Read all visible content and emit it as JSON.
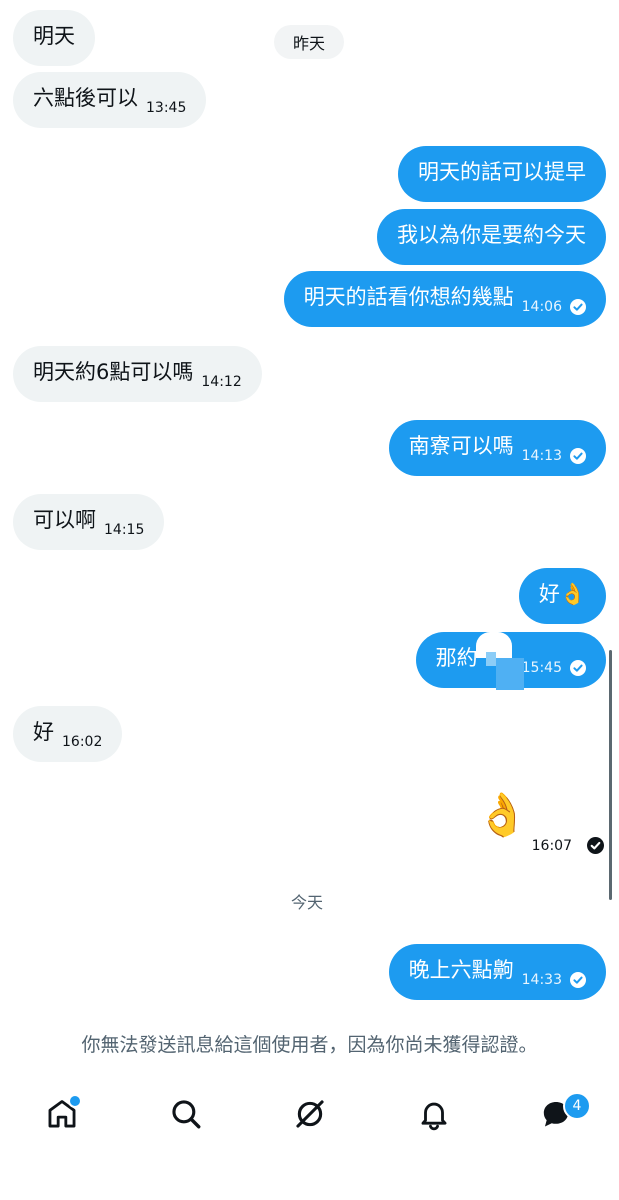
{
  "date_separators": {
    "yesterday": "昨天",
    "today": "今天"
  },
  "messages": [
    {
      "text": "明天",
      "time": ""
    },
    {
      "text": "六點後可以",
      "time": "13:45"
    },
    {
      "text": "明天的話可以提早",
      "time": ""
    },
    {
      "text": "我以為你是要約今天",
      "time": ""
    },
    {
      "text": "明天的話看你想約幾點",
      "time": "14:06"
    },
    {
      "text": "明天約6點可以嗎",
      "time": "14:12"
    },
    {
      "text": "南寮可以嗎",
      "time": "14:13"
    },
    {
      "text": "可以啊",
      "time": "14:15"
    },
    {
      "text": "好👌",
      "time": ""
    },
    {
      "text": "那約",
      "time": "15:45"
    },
    {
      "text": "好",
      "time": "16:02"
    },
    {
      "text": "👌",
      "time": "16:07"
    },
    {
      "text": "晚上六點齁",
      "time": "14:33"
    }
  ],
  "notice": "你無法發送訊息給這個使用者，因為你尚未獲得認證。",
  "nav": {
    "messages_badge": "4"
  },
  "colors": {
    "accent": "#1d9bf0",
    "incoming_bubble": "#eff3f4",
    "secondary_text": "#536471"
  },
  "icons": {
    "read": "check-circle-icon",
    "home": "home-icon",
    "search": "search-icon",
    "grok": "grok-icon",
    "notifications": "bell-icon",
    "messages": "chat-bubble-icon"
  }
}
